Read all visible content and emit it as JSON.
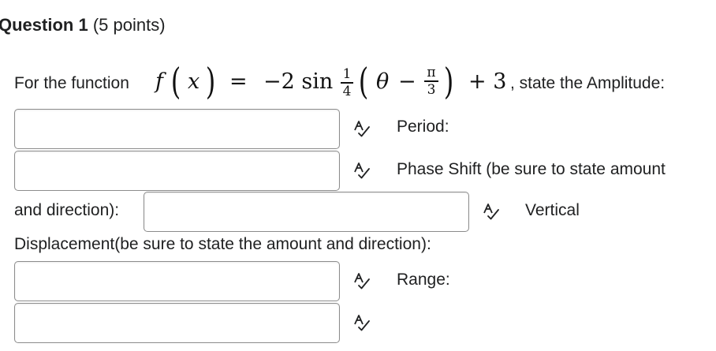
{
  "question": {
    "label": "Question 1",
    "points": "(5 points)"
  },
  "prompt": {
    "intro": "For the function",
    "after_equation": ", state the Amplitude:"
  },
  "equation": {
    "f": "f",
    "x": "x",
    "equals": "=",
    "coefficient": "−2 sin",
    "frac1_num": "1",
    "frac1_den": "4",
    "theta": "θ",
    "minus": "−",
    "frac2_num": "π",
    "frac2_den": "3",
    "plus": "+ 3"
  },
  "fields": {
    "period_label": "Period:",
    "phase_shift_label_line1": "Phase Shift (be sure to state amount",
    "phase_shift_label_line2": "and direction):",
    "vertical_label": "Vertical",
    "vertical_label_line2": "Displacement(be sure to state the amount and direction):",
    "range_label": "Range:"
  },
  "icons": {
    "spell_check": "spell-check-icon"
  }
}
